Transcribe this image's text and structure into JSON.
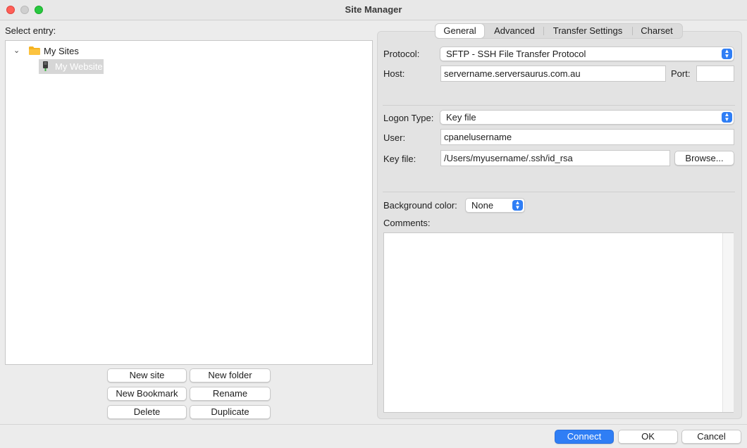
{
  "window": {
    "title": "Site Manager"
  },
  "left": {
    "select_label": "Select entry:",
    "tree": {
      "folder_label": "My Sites",
      "site_label": "My Website"
    },
    "buttons": {
      "new_site": "New site",
      "new_folder": "New folder",
      "new_bookmark": "New Bookmark",
      "rename": "Rename",
      "delete": "Delete",
      "duplicate": "Duplicate"
    }
  },
  "tabs": [
    {
      "label": "General",
      "active": true
    },
    {
      "label": "Advanced"
    },
    {
      "label": "Transfer Settings"
    },
    {
      "label": "Charset"
    }
  ],
  "general": {
    "protocol_label": "Protocol:",
    "protocol_value": "SFTP - SSH File Transfer Protocol",
    "host_label": "Host:",
    "host_value": "servername.serversaurus.com.au",
    "port_label": "Port:",
    "port_value": "",
    "logon_type_label": "Logon Type:",
    "logon_type_value": "Key file",
    "user_label": "User:",
    "user_value": "cpanelusername",
    "key_file_label": "Key file:",
    "key_file_value": "/Users/myusername/.ssh/id_rsa",
    "browse_button": "Browse...",
    "bg_color_label": "Background color:",
    "bg_color_value": "None",
    "comments_label": "Comments:",
    "comments_value": ""
  },
  "footer": {
    "connect": "Connect",
    "ok": "OK",
    "cancel": "Cancel"
  },
  "icons": [
    "chevron-down-icon",
    "folder-icon",
    "server-icon",
    "updown-arrows-icon"
  ],
  "colors": {
    "accent": "#2f7ef5",
    "folder": "#f5b321",
    "close": "#ff5f57",
    "maximize": "#28c840"
  }
}
